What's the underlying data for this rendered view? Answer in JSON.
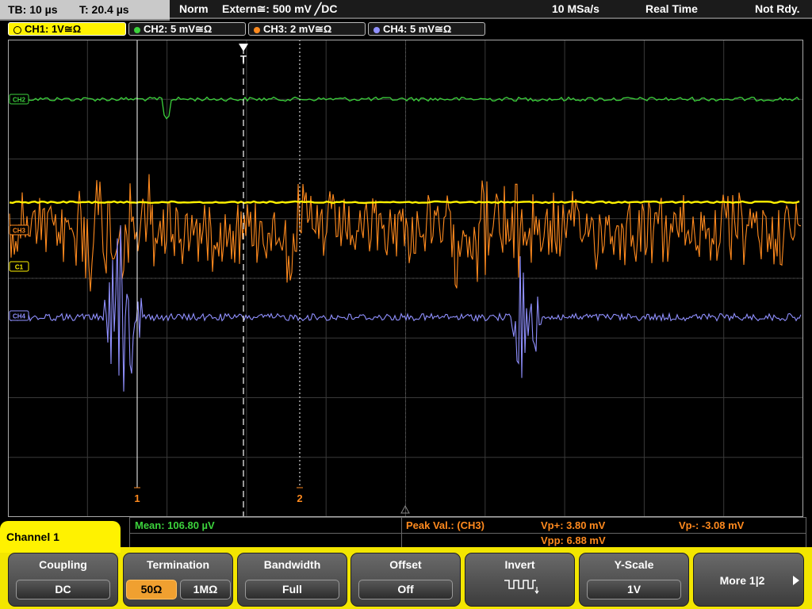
{
  "timebase": {
    "tb": "TB: 10 µs",
    "trigger_time": "T: 20.4 µs"
  },
  "status": {
    "mode": "Norm",
    "trigger": "Extern≅: 500 mV ╱DC",
    "samplerate": "10 MSa/s",
    "acq_mode": "Real Time",
    "state": "Not Rdy."
  },
  "channels": [
    {
      "label": "CH1: 1V≅Ω",
      "color": "#fff200",
      "active": true
    },
    {
      "label": "CH2: 5 mV≅Ω",
      "color": "#3cd23c",
      "active": false
    },
    {
      "label": "CH3: 2 mV≅Ω",
      "color": "#ff8a1e",
      "active": false
    },
    {
      "label": "CH4: 5 mV≅Ω",
      "color": "#9090ff",
      "active": false
    }
  ],
  "trace_markers": {
    "ch2": "CH2",
    "ch3": "CH3",
    "ch1": "C1",
    "ch4": "CH4"
  },
  "trigger_marker": "T",
  "cursors": {
    "c1": "1",
    "c2": "2"
  },
  "measurements": {
    "mean": "Mean: 106.80 µV",
    "peak_title": "Peak Val.:  (CH3)",
    "vp_plus": "Vp+: 3.80 mV",
    "vpp": "Vpp: 6.88 mV",
    "vp_minus": "Vp-: -3.08 mV"
  },
  "menu_title": "Channel 1",
  "softkeys": {
    "coupling": {
      "label": "Coupling",
      "value": "DC"
    },
    "termination": {
      "label": "Termination",
      "opt1": "50Ω",
      "opt2": "1MΩ"
    },
    "bandwidth": {
      "label": "Bandwidth",
      "value": "Full"
    },
    "offset": {
      "label": "Offset",
      "value": "Off"
    },
    "invert": {
      "label": "Invert"
    },
    "yscale": {
      "label": "Y-Scale",
      "value": "1V"
    },
    "more": {
      "label": "More 1|2"
    }
  },
  "colors": {
    "ch1": "#fff200",
    "ch2": "#3cd23c",
    "ch3": "#ff8a1e",
    "ch4": "#9090ff",
    "menu": "#fff200"
  }
}
